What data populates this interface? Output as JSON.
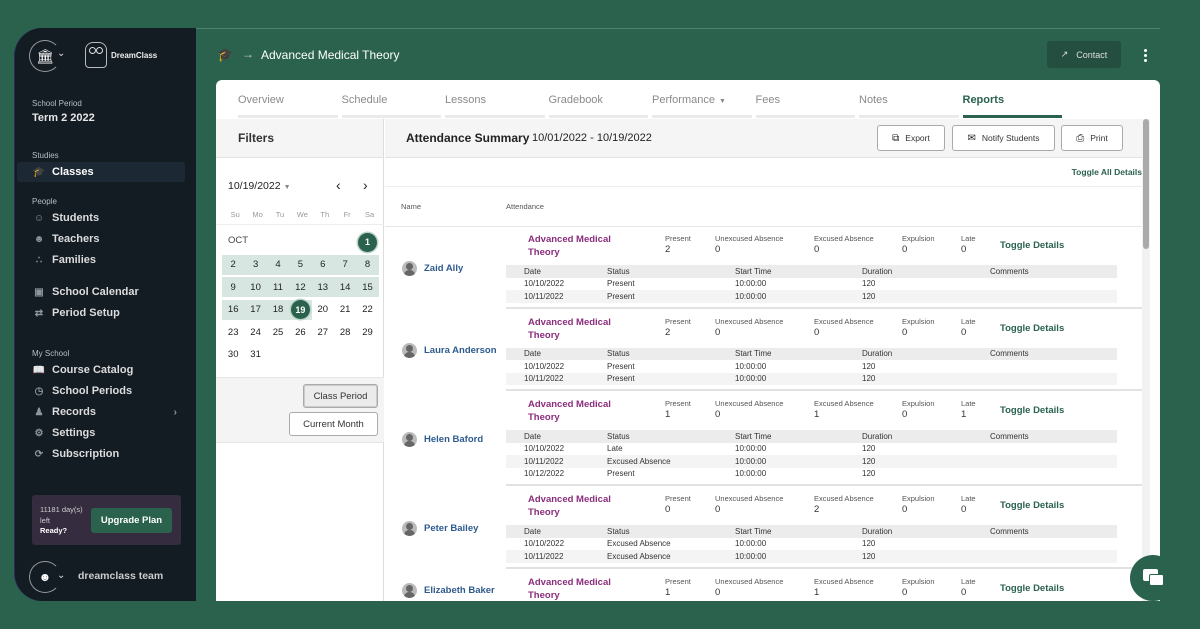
{
  "sidebar": {
    "brand": "DreamClass",
    "school_period_label": "School Period",
    "school_period_value": "Term 2 2022",
    "sections": {
      "studies": "Studies",
      "people": "People",
      "my_school": "My School"
    },
    "items": [
      {
        "label": "Classes",
        "icon": "graduation-cap-icon",
        "active": true
      },
      {
        "label": "Students",
        "icon": "user-icon"
      },
      {
        "label": "Teachers",
        "icon": "teacher-icon"
      },
      {
        "label": "Families",
        "icon": "family-icon"
      },
      {
        "label": "School Calendar",
        "icon": "calendar-icon"
      },
      {
        "label": "Period Setup",
        "icon": "swap-icon"
      },
      {
        "label": "Course Catalog",
        "icon": "book-icon"
      },
      {
        "label": "School Periods",
        "icon": "clock-icon"
      },
      {
        "label": "Records",
        "icon": "group-icon",
        "has_submenu": true
      },
      {
        "label": "Settings",
        "icon": "gear-icon"
      },
      {
        "label": "Subscription",
        "icon": "sync-icon"
      }
    ],
    "upgrade": {
      "days_left": "11181 day(s) left",
      "ready": "Ready?",
      "button": "Upgrade Plan"
    },
    "user_name": "dreamclass team"
  },
  "header": {
    "breadcrumb_title": "Advanced Medical Theory",
    "contact_label": "Contact"
  },
  "tabs": [
    {
      "label": "Overview"
    },
    {
      "label": "Schedule"
    },
    {
      "label": "Lessons"
    },
    {
      "label": "Gradebook"
    },
    {
      "label": "Performance",
      "dropdown": true
    },
    {
      "label": "Fees"
    },
    {
      "label": "Notes"
    },
    {
      "label": "Reports",
      "active": true
    }
  ],
  "filters": {
    "title": "Filters",
    "selected_date": "10/19/2022",
    "weekdays": [
      "Su",
      "Mo",
      "Tu",
      "We",
      "Th",
      "Fr",
      "Sa"
    ],
    "month_label": "OCT",
    "weeks": [
      [
        "",
        "",
        "",
        "",
        "",
        "",
        "1"
      ],
      [
        "2",
        "3",
        "4",
        "5",
        "6",
        "7",
        "8"
      ],
      [
        "9",
        "10",
        "11",
        "12",
        "13",
        "14",
        "15"
      ],
      [
        "16",
        "17",
        "18",
        "19",
        "20",
        "21",
        "22"
      ],
      [
        "23",
        "24",
        "25",
        "26",
        "27",
        "28",
        "29"
      ],
      [
        "30",
        "31",
        "",
        "",
        "",
        "",
        ""
      ]
    ],
    "range_start": "1",
    "range_end": "19",
    "buttons": {
      "class_period": "Class Period",
      "current_month": "Current Month"
    }
  },
  "report": {
    "title": "Attendance Summary",
    "date_range": "10/01/2022 - 10/19/2022",
    "actions": {
      "export": "Export",
      "notify": "Notify Students",
      "print": "Print"
    },
    "toggle_all": "Toggle All Details",
    "columns": {
      "name": "Name",
      "attendance": "Attendance"
    },
    "stat_labels": {
      "present": "Present",
      "unexcused": "Unexcused Absence",
      "excused": "Excused Absence",
      "expulsion": "Expulsion",
      "late": "Late"
    },
    "toggle_details": "Toggle Details",
    "detail_headers": {
      "date": "Date",
      "status": "Status",
      "start_time": "Start Time",
      "duration": "Duration",
      "comments": "Comments"
    },
    "students": [
      {
        "name": "Zaid Ally",
        "course": "Advanced Medical Theory",
        "present": "2",
        "unexcused": "0",
        "excused": "0",
        "expulsion": "0",
        "late": "0",
        "records": [
          {
            "date": "10/10/2022",
            "status": "Present",
            "start": "10:00:00",
            "duration": "120",
            "comments": ""
          },
          {
            "date": "10/11/2022",
            "status": "Present",
            "start": "10:00:00",
            "duration": "120",
            "comments": ""
          }
        ]
      },
      {
        "name": "Laura Anderson",
        "course": "Advanced Medical Theory",
        "present": "2",
        "unexcused": "0",
        "excused": "0",
        "expulsion": "0",
        "late": "0",
        "records": [
          {
            "date": "10/10/2022",
            "status": "Present",
            "start": "10:00:00",
            "duration": "120",
            "comments": ""
          },
          {
            "date": "10/11/2022",
            "status": "Present",
            "start": "10:00:00",
            "duration": "120",
            "comments": ""
          }
        ]
      },
      {
        "name": "Helen Baford",
        "course": "Advanced Medical Theory",
        "present": "1",
        "unexcused": "0",
        "excused": "1",
        "expulsion": "0",
        "late": "1",
        "records": [
          {
            "date": "10/10/2022",
            "status": "Late",
            "start": "10:00:00",
            "duration": "120",
            "comments": ""
          },
          {
            "date": "10/11/2022",
            "status": "Excused Absence",
            "start": "10:00:00",
            "duration": "120",
            "comments": ""
          },
          {
            "date": "10/12/2022",
            "status": "Present",
            "start": "10:00:00",
            "duration": "120",
            "comments": ""
          }
        ]
      },
      {
        "name": "Peter Bailey",
        "course": "Advanced Medical Theory",
        "present": "0",
        "unexcused": "0",
        "excused": "2",
        "expulsion": "0",
        "late": "0",
        "records": [
          {
            "date": "10/10/2022",
            "status": "Excused Absence",
            "start": "10:00:00",
            "duration": "120",
            "comments": ""
          },
          {
            "date": "10/11/2022",
            "status": "Excused Absence",
            "start": "10:00:00",
            "duration": "120",
            "comments": ""
          }
        ]
      },
      {
        "name": "Elizabeth Baker",
        "course": "Advanced Medical Theory",
        "present": "1",
        "unexcused": "0",
        "excused": "1",
        "expulsion": "0",
        "late": "0",
        "records": []
      }
    ]
  },
  "colors": {
    "brand_green": "#2a624e",
    "sidebar_bg": "#131b23",
    "course_purple": "#8b2d7d",
    "student_blue": "#2e5b8f",
    "range_highlight": "#d7e6e0"
  }
}
